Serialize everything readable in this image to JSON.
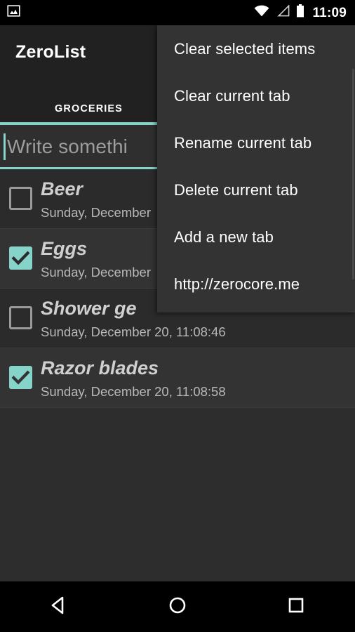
{
  "status_bar": {
    "left_icon": "screenshot-image-icon",
    "icons": [
      "wifi-icon",
      "cell-signal-icon",
      "battery-icon"
    ],
    "clock": "11:09"
  },
  "app": {
    "title": "ZeroList",
    "accent_color": "#86d3c9",
    "header_bg": "#212121",
    "list_bg": "#2b2b2b",
    "menu_bg": "#333333"
  },
  "tabs": [
    {
      "label": "GROCERIES",
      "selected": true
    }
  ],
  "input": {
    "value": "",
    "placeholder": "Write somethi"
  },
  "items": [
    {
      "name": "Beer",
      "date": "Sunday, December",
      "checked": false
    },
    {
      "name": "Eggs",
      "date": "Sunday, December",
      "checked": true
    },
    {
      "name": "Shower ge",
      "date": "Sunday, December 20, 11:08:46",
      "checked": false
    },
    {
      "name": "Razor blades",
      "date": "Sunday, December 20, 11:08:58",
      "checked": true
    }
  ],
  "overflow_menu": {
    "items": [
      {
        "label": "Clear selected items"
      },
      {
        "label": "Clear current tab"
      },
      {
        "label": "Rename current tab"
      },
      {
        "label": "Delete current tab"
      },
      {
        "label": "Add a new tab"
      },
      {
        "label": "http://zerocore.me"
      }
    ]
  },
  "nav_bar": {
    "back": "back-triangle-icon",
    "home": "home-circle-icon",
    "recents": "recents-square-icon"
  }
}
